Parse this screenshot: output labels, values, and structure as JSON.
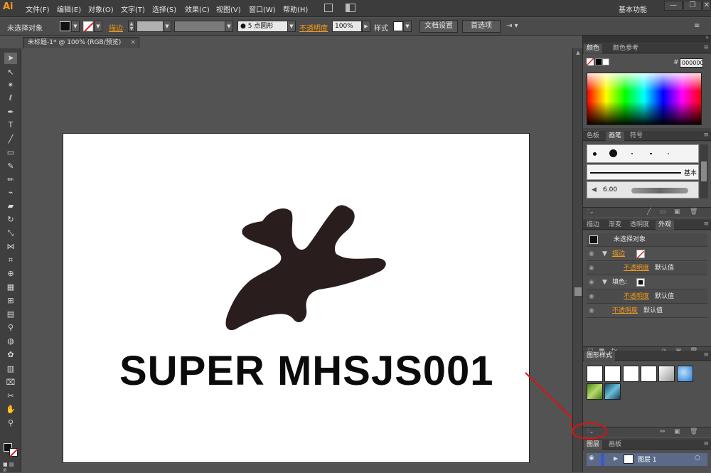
{
  "app": {
    "logo": "Ai"
  },
  "menu": [
    "文件(F)",
    "编辑(E)",
    "对象(O)",
    "文字(T)",
    "选择(S)",
    "效果(C)",
    "视图(V)",
    "窗口(W)",
    "帮助(H)"
  ],
  "workspace": {
    "label": "基本功能"
  },
  "window_buttons": [
    "—",
    "❐",
    "✕"
  ],
  "controlbar": {
    "no_selection": "未选择对象",
    "stroke_label": "描边",
    "brush_label": "5 点圆形",
    "opacity_label": "不透明度",
    "opacity_value": "100%",
    "style_label": "样式",
    "doc_setup": "文档设置",
    "preferences": "首选项"
  },
  "document": {
    "tab_title": "未标题-1* @ 100% (RGB/预览)",
    "close": "×"
  },
  "artwork": {
    "text": "SUPER MHSJS001",
    "shape_color": "#2a1d1d"
  },
  "panels": {
    "color": {
      "tabs": [
        "颜色",
        "颜色参考"
      ],
      "hex_label": "#",
      "hex_value": "000000"
    },
    "brushes": {
      "tabs": [
        "色板",
        "画笔",
        "符号"
      ],
      "basic_label": "基本",
      "size_value": "6.00"
    },
    "appearance": {
      "tabs": [
        "描边",
        "渐变",
        "透明度",
        "外观"
      ],
      "header": "未选择对象",
      "rows": [
        {
          "label": "描边",
          "value": ""
        },
        {
          "label": "不透明度",
          "value": "默认值"
        },
        {
          "label": "填色:",
          "value": ""
        },
        {
          "label": "不透明度",
          "value": "默认值"
        },
        {
          "label": "不透明度",
          "value": "默认值"
        }
      ]
    },
    "graphic_styles": {
      "title": "图形样式"
    },
    "layers": {
      "tabs": [
        "图层",
        "画板"
      ],
      "layer_name": "图层 1"
    }
  },
  "annotation": {
    "color": "#e01010"
  }
}
